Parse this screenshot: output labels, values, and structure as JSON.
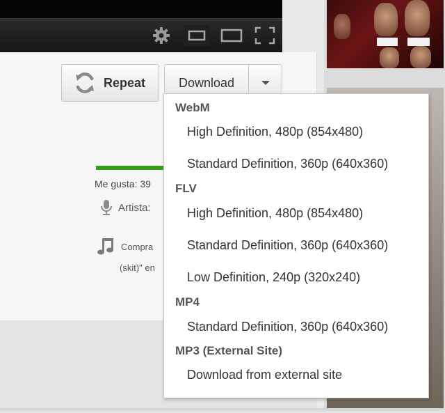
{
  "buttons": {
    "repeat_label": "Repeat",
    "download_label": "Download"
  },
  "video_info": {
    "likes_text": "Me gusta: 39",
    "artist_text": "Artista:",
    "buy_text": "Compra",
    "buy_subtext": "(skit)\" en"
  },
  "download_menu": {
    "groups": [
      {
        "header": "WebM",
        "items": [
          "High Definition, 480p (854x480)",
          "Standard Definition, 360p (640x360)"
        ]
      },
      {
        "header": "FLV",
        "items": [
          "High Definition, 480p (854x480)",
          "Standard Definition, 360p (640x360)",
          "Low Definition, 240p (320x240)"
        ]
      },
      {
        "header": "MP4",
        "items": [
          "Standard Definition, 360p (640x360)"
        ]
      },
      {
        "header": "MP3 (External Site)",
        "items": [
          "Download from external site"
        ]
      }
    ]
  },
  "icons": {
    "player_controls": [
      "gear-icon",
      "small-player-icon",
      "large-player-icon",
      "fullscreen-icon"
    ],
    "repeat": "repeat-icon",
    "dropdown": "caret-down-icon",
    "artist": "microphone-icon",
    "buy": "music-note-icon"
  },
  "colors": {
    "like_bar": "#3a9a1e",
    "player_bg": "#111111",
    "menu_bg": "#ffffff"
  }
}
